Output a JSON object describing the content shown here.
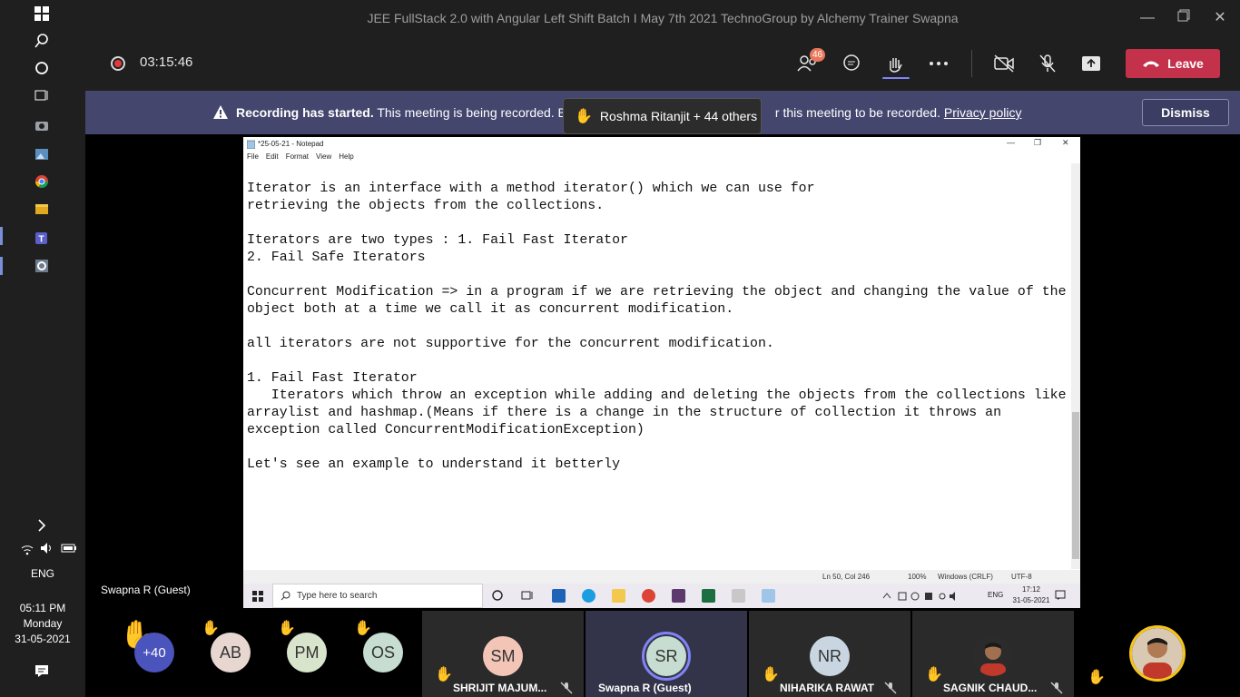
{
  "os_taskbar": {
    "language": "ENG",
    "time": "05:11 PM",
    "day": "Monday",
    "date": "31-05-2021"
  },
  "window": {
    "title": "JEE FullStack 2.0 with Angular Left Shift Batch I May 7th 2021 TechnoGroup by Alchemy Trainer Swapna"
  },
  "meeting": {
    "timer": "03:15:46",
    "participants_badge": "46",
    "leave_label": "Leave"
  },
  "banner": {
    "bold": "Recording has started.",
    "text_before": " This meeting is being recorded. B",
    "text_after": "r this meeting to be recorded. ",
    "link": "Privacy policy",
    "dismiss_label": "Dismiss"
  },
  "hand_toast": "Roshma Ritanjit + 44 others",
  "presenter_name": "Swapna R (Guest)",
  "notepad": {
    "title": "*25-05-21 - Notepad",
    "menu": [
      "File",
      "Edit",
      "Format",
      "View",
      "Help"
    ],
    "lines": [
      "Iterator is an interface with a method iterator() which we can use for",
      "retrieving the objects from the collections.",
      "",
      "Iterators are two types : 1. Fail Fast Iterator",
      "2. Fail Safe Iterators",
      "",
      "Concurrent Modification => in a program if we are retrieving the object and changing the value of the",
      "object both at a time we call it as concurrent modification.",
      "",
      "all iterators are not supportive for the concurrent modification.",
      "",
      "1. Fail Fast Iterator",
      "   Iterators which throw an exception while adding and deleting the objects from the collections like",
      "arraylist and hashmap.(Means if there is a change in the structure of collection it throws an",
      "exception called ConcurrentModificationException)",
      "",
      "Let's see an example to understand it betterly"
    ],
    "status": {
      "position": "Ln 50, Col 246",
      "zoom": "100%",
      "line_endings": "Windows (CRLF)",
      "encoding": "UTF-8"
    }
  },
  "shared_taskbar": {
    "search_placeholder": "Type here to search",
    "language": "ENG",
    "time": "17:12",
    "date": "31-05-2021"
  },
  "participants": {
    "overflow": "+40",
    "avatars": [
      {
        "initials": "AB",
        "color": "#e8d7d0"
      },
      {
        "initials": "PM",
        "color": "#d8e4cb"
      },
      {
        "initials": "OS",
        "color": "#c7ddd2"
      }
    ],
    "tiles": [
      {
        "initials": "SM",
        "name": "SHRIJIT MAJUM...",
        "color": "#f2c5b7"
      },
      {
        "initials": "SR",
        "name": "Swapna R (Guest)",
        "color": "#c7ddd2"
      },
      {
        "initials": "NR",
        "name": "NIHARIKA RAWAT",
        "color": "#c9d6e2"
      },
      {
        "initials": "",
        "name": "SAGNIK CHAUD...",
        "color": "#5a3c2c"
      }
    ]
  }
}
